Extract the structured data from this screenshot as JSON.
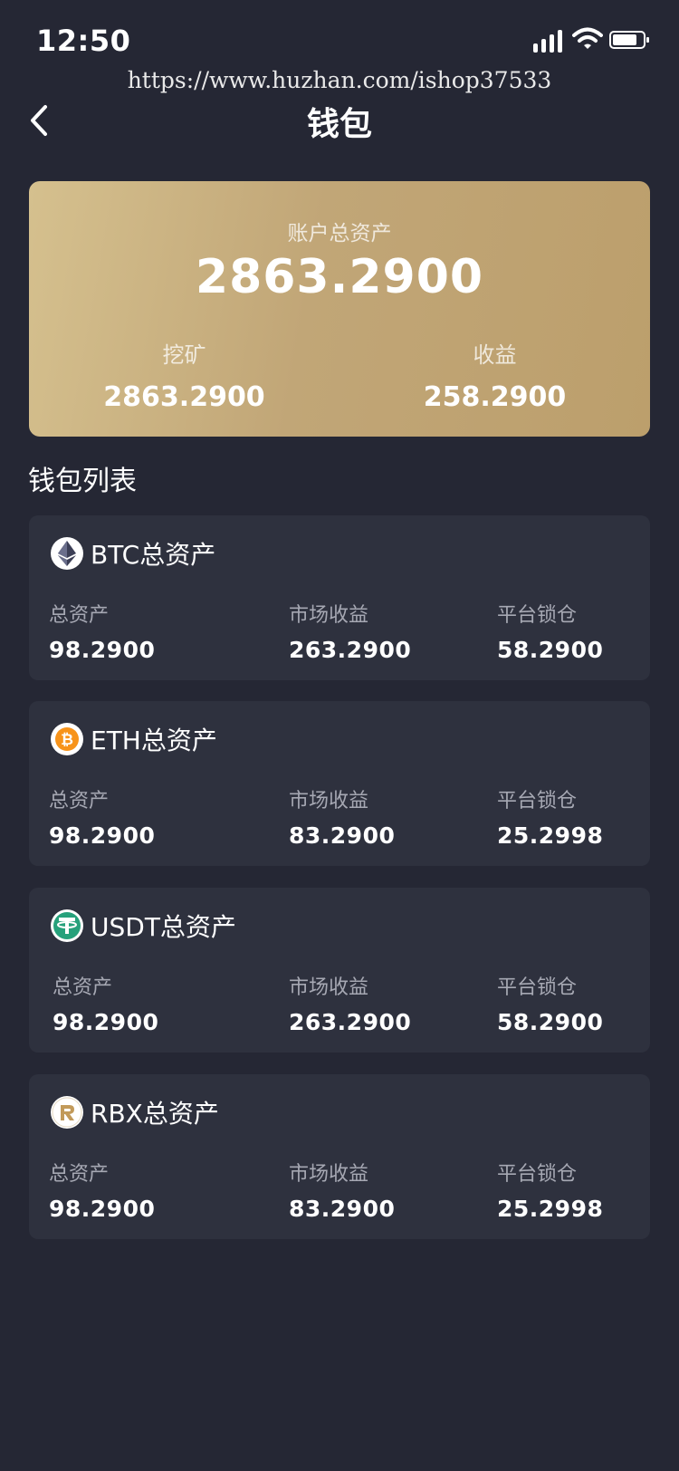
{
  "status": {
    "time": "12:50"
  },
  "watermark": "https://www.huzhan.com/ishop37533",
  "nav": {
    "title": "钱包"
  },
  "account": {
    "total_label": "账户总资产",
    "total_value": "2863.2900",
    "mining_label": "挖矿",
    "mining_value": "2863.2900",
    "income_label": "收益",
    "income_value": "258.2900"
  },
  "wallet_list_title": "钱包列表",
  "labels": {
    "total": "总资产",
    "market": "市场收益",
    "locked": "平台锁仓"
  },
  "wallets": [
    {
      "icon": "ethereum-icon",
      "title": "BTC总资产",
      "total": "98.2900",
      "market": "263.2900",
      "locked": "58.2900"
    },
    {
      "icon": "bitcoin-icon",
      "title": "ETH总资产",
      "total": "98.2900",
      "market": "83.2900",
      "locked": "25.2998"
    },
    {
      "icon": "tether-icon",
      "title": "USDT总资产",
      "total": "98.2900",
      "market": "263.2900",
      "locked": "58.2900"
    },
    {
      "icon": "rbx-icon",
      "title": "RBX总资产",
      "total": "98.2900",
      "market": "83.2900",
      "locked": "25.2998"
    }
  ],
  "colors": {
    "background": "#252734",
    "card": "#2e313e",
    "gold": "#c1a677",
    "usdt": "#26a17b",
    "btc": "#f7931a"
  }
}
